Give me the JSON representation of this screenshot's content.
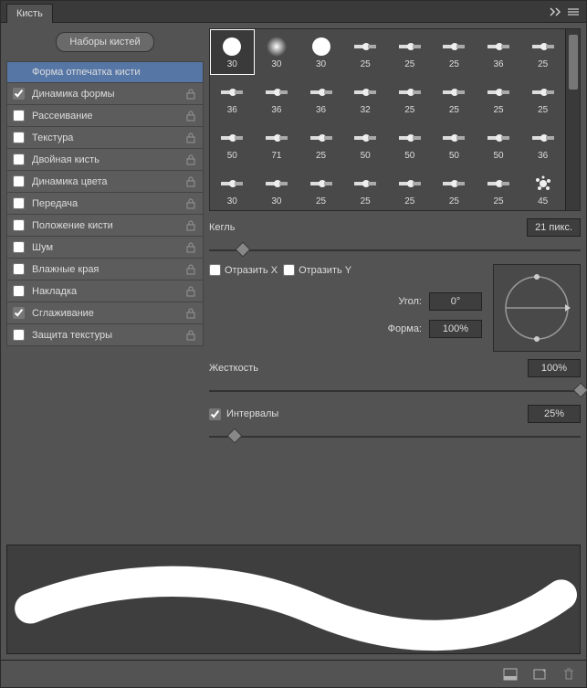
{
  "title": "Кисть",
  "presets_button": "Наборы кистей",
  "options": [
    {
      "label": "Форма отпечатка кисти",
      "checked": null,
      "lock": false,
      "selected": true
    },
    {
      "label": "Динамика формы",
      "checked": true,
      "lock": true
    },
    {
      "label": "Рассеивание",
      "checked": false,
      "lock": true
    },
    {
      "label": "Текстура",
      "checked": false,
      "lock": true
    },
    {
      "label": "Двойная кисть",
      "checked": false,
      "lock": true
    },
    {
      "label": "Динамика цвета",
      "checked": false,
      "lock": true
    },
    {
      "label": "Передача",
      "checked": false,
      "lock": true
    },
    {
      "label": "Положение кисти",
      "checked": false,
      "lock": true
    },
    {
      "label": "Шум",
      "checked": false,
      "lock": true
    },
    {
      "label": "Влажные края",
      "checked": false,
      "lock": true
    },
    {
      "label": "Накладка",
      "checked": false,
      "lock": true
    },
    {
      "label": "Сглаживание",
      "checked": true,
      "lock": true
    },
    {
      "label": "Защита текстуры",
      "checked": false,
      "lock": true
    }
  ],
  "brushes": [
    {
      "size": 30,
      "t": "hard"
    },
    {
      "size": 30,
      "t": "soft"
    },
    {
      "size": 30,
      "t": "hard"
    },
    {
      "size": 25,
      "t": "flat"
    },
    {
      "size": 25,
      "t": "flat"
    },
    {
      "size": 25,
      "t": "flat"
    },
    {
      "size": 36,
      "t": "flat"
    },
    {
      "size": 25,
      "t": "flat"
    },
    {
      "size": 36,
      "t": "flat"
    },
    {
      "size": 36,
      "t": "flat"
    },
    {
      "size": 36,
      "t": "flat"
    },
    {
      "size": 32,
      "t": "flat"
    },
    {
      "size": 25,
      "t": "flat"
    },
    {
      "size": 25,
      "t": "flat"
    },
    {
      "size": 25,
      "t": "flat"
    },
    {
      "size": 25,
      "t": "flat"
    },
    {
      "size": 50,
      "t": "flat"
    },
    {
      "size": 71,
      "t": "flat"
    },
    {
      "size": 25,
      "t": "flat"
    },
    {
      "size": 50,
      "t": "flat"
    },
    {
      "size": 50,
      "t": "flat"
    },
    {
      "size": 50,
      "t": "flat"
    },
    {
      "size": 50,
      "t": "flat"
    },
    {
      "size": 36,
      "t": "flat"
    },
    {
      "size": 30,
      "t": "flat"
    },
    {
      "size": 30,
      "t": "flat"
    },
    {
      "size": 25,
      "t": "flat"
    },
    {
      "size": 25,
      "t": "flat"
    },
    {
      "size": 25,
      "t": "flat"
    },
    {
      "size": 25,
      "t": "flat"
    },
    {
      "size": 25,
      "t": "flat"
    },
    {
      "size": 45,
      "t": "splat"
    }
  ],
  "kegl_label": "Кегль",
  "kegl_value": "21 пикс.",
  "flip_x_label": "Отразить X",
  "flip_y_label": "Отразить Y",
  "angle_label": "Угол:",
  "angle_value": "0°",
  "shape_label": "Форма:",
  "shape_value": "100%",
  "hardness_label": "Жесткость",
  "hardness_value": "100%",
  "spacing_label": "Интервалы",
  "spacing_value": "25%",
  "slider_positions": {
    "kegl": 9,
    "hardness": 100,
    "spacing": 7
  }
}
